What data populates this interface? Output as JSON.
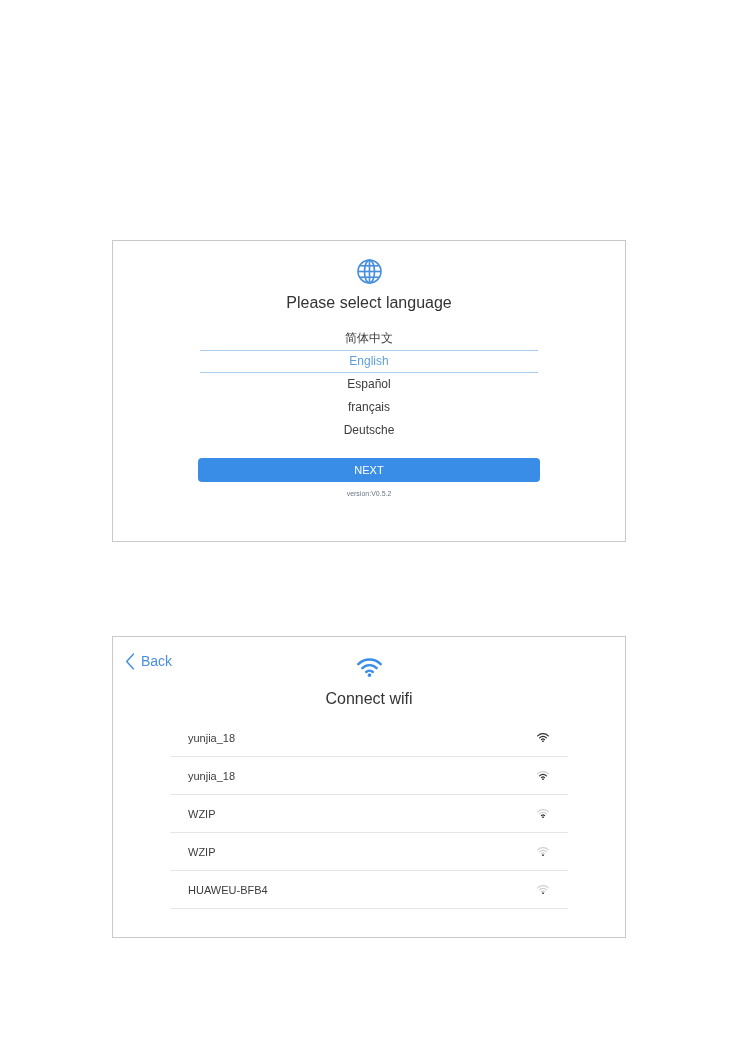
{
  "language_screen": {
    "title": "Please select language",
    "languages": [
      {
        "label": "简体中文",
        "selected": false
      },
      {
        "label": "English",
        "selected": true
      },
      {
        "label": "Español",
        "selected": false
      },
      {
        "label": "français",
        "selected": false
      },
      {
        "label": "Deutsche",
        "selected": false
      }
    ],
    "next_button": "NEXT",
    "version": "version:V0.5.2"
  },
  "wifi_screen": {
    "back_button": "Back",
    "title": "Connect wifi",
    "networks": [
      {
        "name": "yunjia_18",
        "kind": "strong"
      },
      {
        "name": "yunjia_18",
        "kind": "good"
      },
      {
        "name": "WZIP",
        "kind": "fair"
      },
      {
        "name": "WZIP",
        "kind": "weak"
      },
      {
        "name": "HUAWEU-BFB4",
        "kind": "weak"
      }
    ]
  }
}
